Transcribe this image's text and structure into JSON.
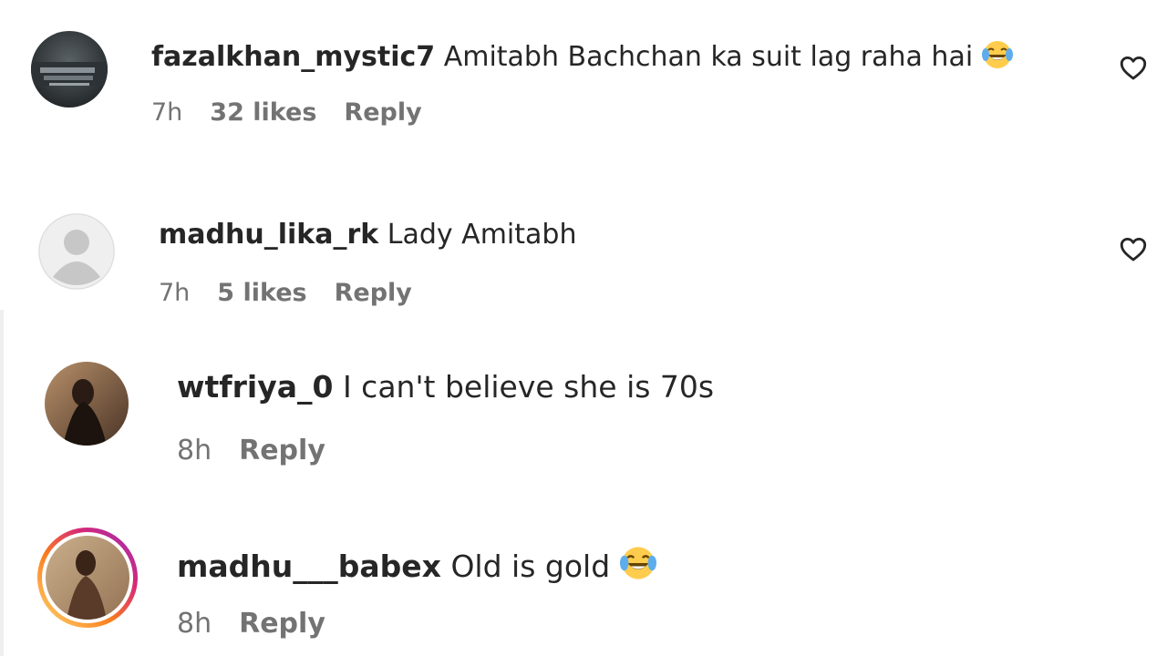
{
  "comments": [
    {
      "username": "fazalkhan_mystic7",
      "text": "Amitabh Bachchan ka suit lag raha hai",
      "emoji": "tears-of-joy-emoji",
      "time": "7h",
      "likes": "32 likes",
      "reply": "Reply",
      "avatar": "dark-photo-avatar"
    },
    {
      "username": "madhu_lika_rk",
      "text": "Lady Amitabh",
      "time": "7h",
      "likes": "5 likes",
      "reply": "Reply",
      "avatar": "default-person-avatar"
    },
    {
      "username": "wtfriya_0",
      "text": "I can't believe she is 70s",
      "time": "8h",
      "reply": "Reply",
      "avatar": "photo-avatar"
    },
    {
      "username": "madhu___babex",
      "text": "Old is gold",
      "emoji": "tears-of-joy-emoji",
      "time": "8h",
      "reply": "Reply",
      "avatar": "story-ring-photo-avatar"
    }
  ],
  "colors": {
    "text": "#262626",
    "meta": "#737373",
    "story_ring_start": "#feda75",
    "story_ring_end": "#d62976"
  }
}
